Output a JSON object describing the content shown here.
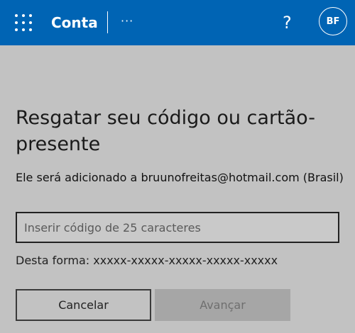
{
  "header": {
    "app_title": "Conta",
    "more_label": "···",
    "help_label": "?",
    "avatar_initials": "BF",
    "brand_color": "#0064b4"
  },
  "main": {
    "title": "Resgatar seu código ou cartão-presente",
    "description": "Ele será adicionado a bruunofreitas@hotmail.com (Brasil)",
    "code_input": {
      "value": "",
      "placeholder": "Inserir código de 25 caracteres"
    },
    "format_hint": "Desta forma: xxxxx-xxxxx-xxxxx-xxxxx-xxxxx",
    "cancel_label": "Cancelar",
    "next_label": "Avançar"
  }
}
